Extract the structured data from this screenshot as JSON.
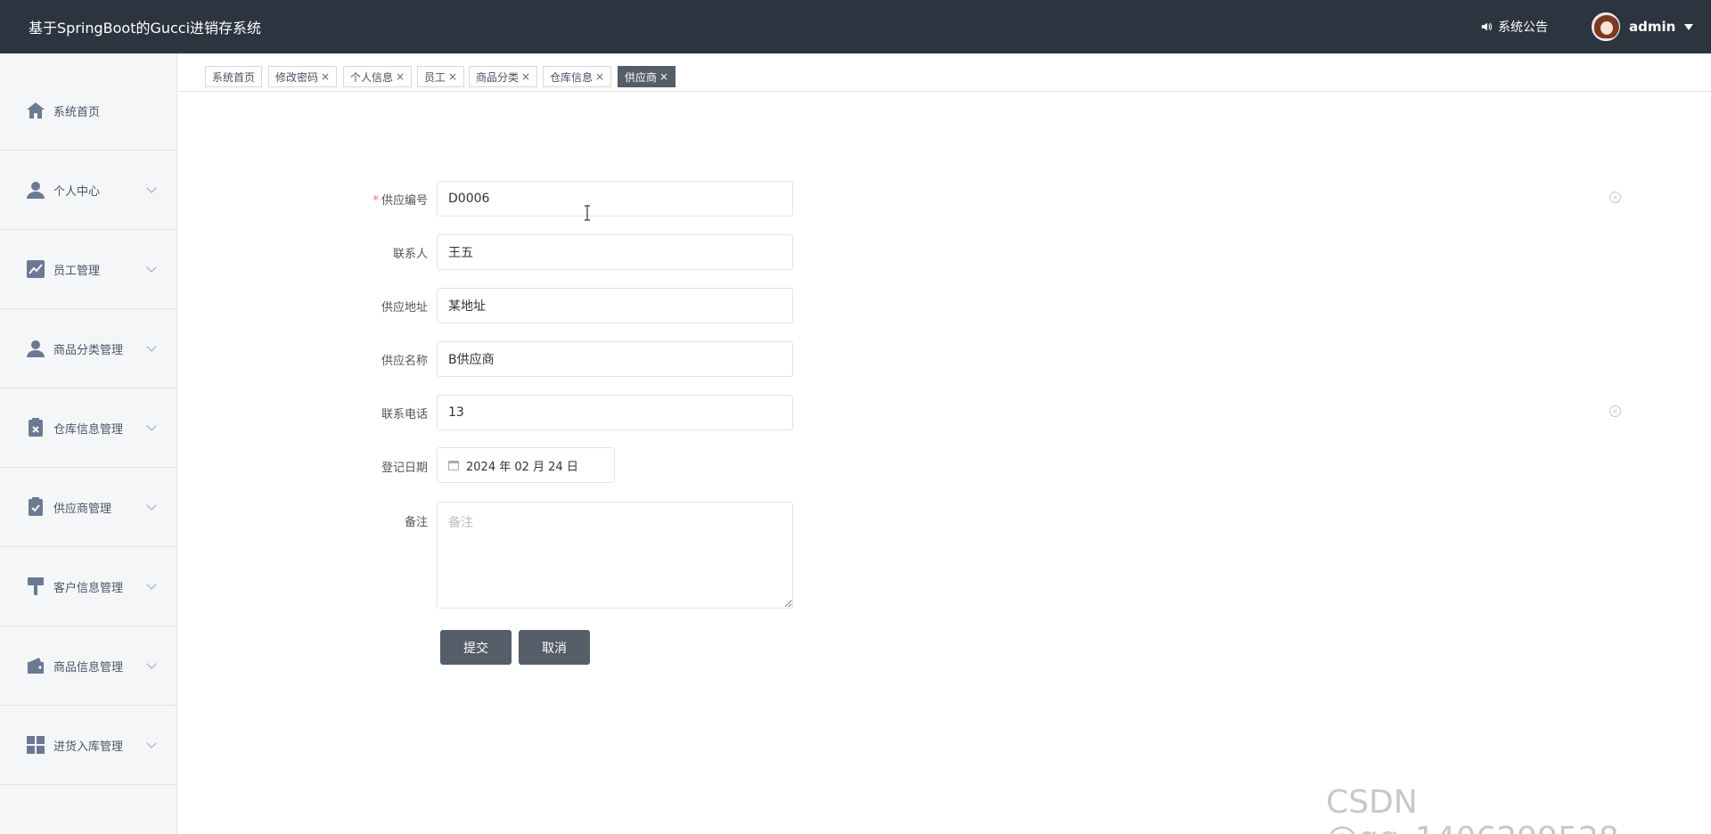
{
  "header": {
    "title": "基于SpringBoot的Gucci进销存系统",
    "notice_label": "系统公告",
    "username": "admin"
  },
  "sidebar": {
    "items": [
      {
        "label": "系统首页",
        "icon": "home-icon"
      },
      {
        "label": "个人中心",
        "icon": "user-icon"
      },
      {
        "label": "员工管理",
        "icon": "chart-line-icon"
      },
      {
        "label": "商品分类管理",
        "icon": "user-icon"
      },
      {
        "label": "仓库信息管理",
        "icon": "clipboard-x-icon"
      },
      {
        "label": "供应商管理",
        "icon": "clipboard-check-icon"
      },
      {
        "label": "客户信息管理",
        "icon": "brush-icon"
      },
      {
        "label": "商品信息管理",
        "icon": "wallet-icon"
      },
      {
        "label": "进货入库管理",
        "icon": "grid-icon"
      }
    ]
  },
  "tabs": [
    {
      "label": "系统首页",
      "closable": false
    },
    {
      "label": "修改密码",
      "closable": true
    },
    {
      "label": "个人信息",
      "closable": true
    },
    {
      "label": "员工",
      "closable": true
    },
    {
      "label": "商品分类",
      "closable": true
    },
    {
      "label": "仓库信息",
      "closable": true
    },
    {
      "label": "供应商",
      "closable": true,
      "active": true
    }
  ],
  "tab_close_glyph": "×",
  "form": {
    "supplier_code_label": "供应编号",
    "supplier_code_value": "D0006",
    "contact_label": "联系人",
    "contact_value": "王五",
    "address_label": "供应地址",
    "address_value": "某地址",
    "name_label": "供应名称",
    "name_value": "B供应商",
    "phone_label": "联系电话",
    "phone_value": "13",
    "date_label": "登记日期",
    "date_value": "2024 年 02 月 24 日",
    "remark_label": "备注",
    "remark_placeholder": "备注",
    "submit_label": "提交",
    "cancel_label": "取消",
    "required_mark": "*"
  },
  "watermark": "CSDN @qq_1406299528",
  "colors": {
    "header_bg": "#2c3440",
    "accent": "#545d68",
    "sidebar_bg": "#f5f6f8"
  }
}
